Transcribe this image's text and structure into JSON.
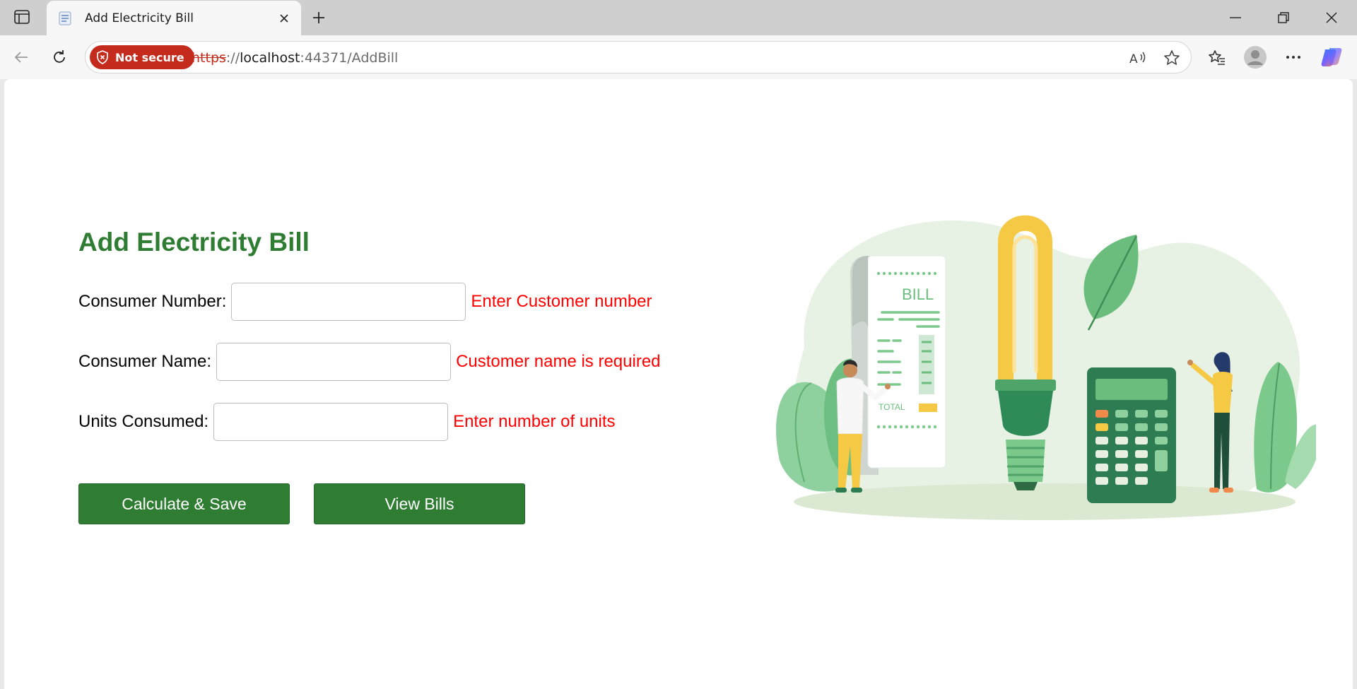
{
  "browser": {
    "tab_title": "Add Electricity Bill",
    "security_label": "Not secure",
    "url_scheme": "https",
    "url_separator": "://",
    "url_host": "localhost",
    "url_rest": ":44371/AddBill"
  },
  "page": {
    "title": "Add Electricity Bill",
    "fields": [
      {
        "label": "Consumer Number:",
        "value": "",
        "error": "Enter Customer number"
      },
      {
        "label": "Consumer Name:",
        "value": "",
        "error": "Customer name is required"
      },
      {
        "label": "Units Consumed:",
        "value": "",
        "error": "Enter number of units"
      }
    ],
    "buttons": {
      "calculate": "Calculate & Save",
      "view": "View Bills"
    }
  },
  "illustration": {
    "receipt_title": "BILL",
    "receipt_total": "TOTAL"
  },
  "colors": {
    "accent": "#2e7d32",
    "error": "#ff0000",
    "security_badge": "#c42b1c"
  }
}
